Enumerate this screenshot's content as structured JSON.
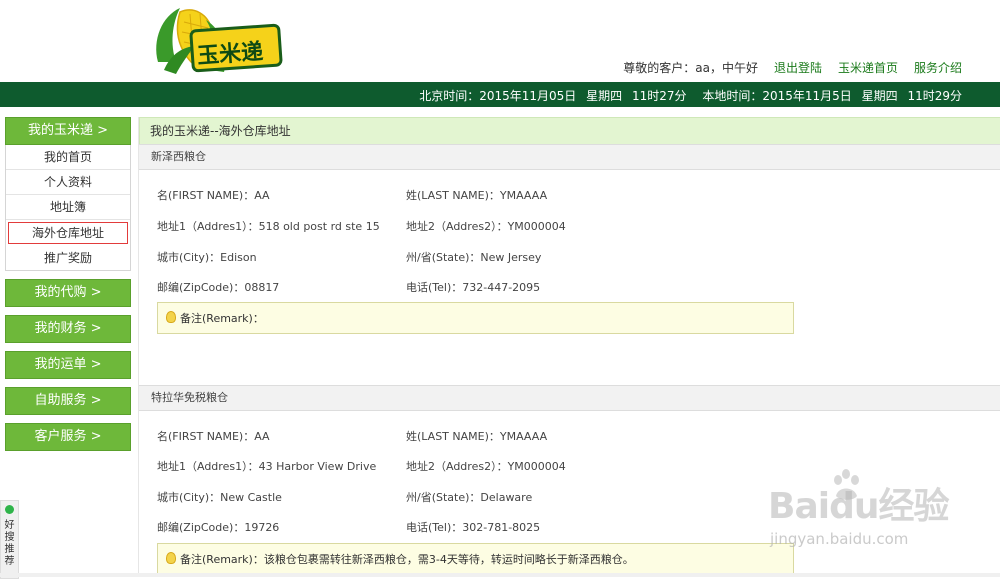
{
  "header": {
    "logo_text": "玉米递",
    "greeting": "尊敬的客户：aa，中午好",
    "links": [
      "退出登陆",
      "玉米递首页",
      "服务介绍"
    ]
  },
  "timebar": {
    "beijing_label": "北京时间：2015年11月05日",
    "beijing_weekday": "星期四",
    "beijing_clock": "11时27分",
    "local_label": "本地时间：2015年11月5日",
    "local_weekday": "星期四",
    "local_clock": "11时29分"
  },
  "sidebar": {
    "head": "我的玉米递  >",
    "items": [
      "我的首页",
      "个人资料",
      "地址簿",
      "海外仓库地址",
      "推广奖励"
    ],
    "buttons": [
      "我的代购  >",
      "我的财务  >",
      "我的运单  >",
      "自助服务  >",
      "客户服务  >"
    ]
  },
  "main": {
    "breadcrumb": "我的玉米递--海外仓库地址",
    "warehouses": [
      {
        "title": "新泽西粮仓",
        "first_name": "名(FIRST NAME)：AA",
        "last_name": "姓(LAST NAME)：YMAAAA",
        "address1": "地址1（Addres1）：518 old post rd ste 15",
        "address2": "地址2（Addres2）：YM000004",
        "city": "城市(City)：Edison",
        "state": "州/省(State)：New Jersey",
        "zip": "邮编(ZipCode)：08817",
        "tel": "电话(Tel)：732-447-2095",
        "remark": "备注(Remark)："
      },
      {
        "title": "特拉华免税粮仓",
        "first_name": "名(FIRST NAME)：AA",
        "last_name": "姓(LAST NAME)：YMAAAA",
        "address1": "地址1（Addres1）：43 Harbor View Drive",
        "address2": "地址2（Addres2）：YM000004",
        "city": "城市(City)：New Castle",
        "state": "州/省(State)：Delaware",
        "zip": "邮编(ZipCode)：19726",
        "tel": "电话(Tel)：302-781-8025",
        "remark": "备注(Remark)：该粮仓包裹需转往新泽西粮仓，需3-4天等待，转运时间略长于新泽西粮仓。"
      }
    ]
  },
  "widget": {
    "label": "好搜推荐"
  },
  "watermark": {
    "brand": "Baidu经验",
    "url": "jingyan.baidu.com"
  },
  "colors": {
    "brand_green": "#0e5b2e",
    "menu_green": "#6eb83a",
    "crumb_bg": "#e3f5d1",
    "active_border": "#e23b3b"
  }
}
